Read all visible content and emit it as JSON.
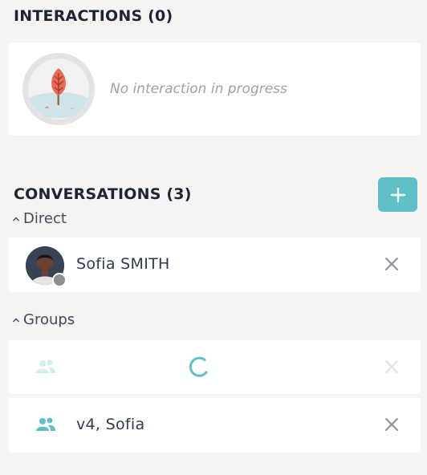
{
  "interactions": {
    "title": "INTERACTIONS (0)",
    "empty_text": "No interaction in progress"
  },
  "conversations": {
    "title": "CONVERSATIONS (3)",
    "add_button_icon": "plus-icon",
    "direct": {
      "label": "Direct",
      "items": [
        {
          "name": "Sofia SMITH",
          "presence": "offline"
        }
      ]
    },
    "groups": {
      "label": "Groups",
      "items": [
        {
          "name": "",
          "state": "loading"
        },
        {
          "name": "v4, Sofia"
        }
      ]
    }
  },
  "colors": {
    "accent": "#5fc0c9",
    "background": "#f5f4f2",
    "card": "#ffffff",
    "muted_text": "#9ea2a8",
    "presence_offline": "#8e8f91"
  }
}
